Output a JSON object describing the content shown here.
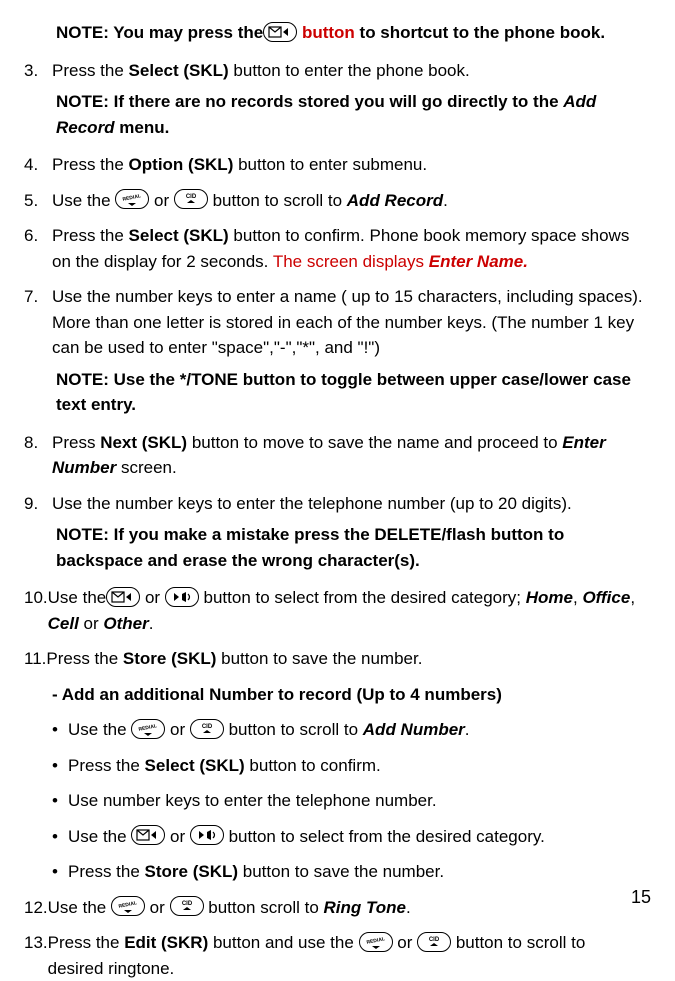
{
  "notes": {
    "shortcut": {
      "prefix": "NOTE: You may press the",
      "button_word": " button",
      "suffix": " to shortcut to the phone book."
    },
    "no_records": "NOTE: If there are no records stored you will go directly to the ",
    "no_records_italic": "Add Record",
    "no_records_end": " menu.",
    "tone_toggle": "NOTE: Use the */TONE button to toggle between upper case/lower case text entry.",
    "delete_flash": "NOTE: If you make a mistake press the DELETE/flash button to backspace and erase the wrong character(s)."
  },
  "steps": {
    "s3": {
      "num": "3.",
      "text_a": "Press the ",
      "bold_a": "Select (SKL)",
      "text_b": " button to enter the phone book."
    },
    "s4": {
      "num": "4.",
      "text_a": "Press the ",
      "bold_a": "Option (SKL)",
      "text_b": " button to enter submenu."
    },
    "s5": {
      "num": "5.",
      "text_a": "Use the ",
      "text_or": " or ",
      "text_b": " button to scroll to ",
      "italic_a": "Add Record",
      "text_c": "."
    },
    "s6": {
      "num": "6.",
      "text_a": "Press the ",
      "bold_a": "Select (SKL)",
      "text_b": " button to confirm. Phone book memory space shows on the display for 2 seconds. ",
      "red_a": "The screen displays ",
      "italic_a": "Enter Name."
    },
    "s7": {
      "num": "7.",
      "text_a": "Use the number keys to enter a name ( up to 15 characters, including spaces). More than one letter is stored in each of the number keys. (The number 1 key can be used to enter \"space\",\"-\",\"*\", and \"!\")"
    },
    "s8": {
      "num": "8.",
      "text_a": "Press ",
      "bold_a": "Next (SKL)",
      "text_b": " button to move to save the name and proceed to  ",
      "italic_a": "Enter Number",
      "text_c": " screen."
    },
    "s9": {
      "num": "9.",
      "text_a": "Use the number keys to enter the telephone number (up to 20 digits)."
    },
    "s10": {
      "num": "10.",
      "text_a": "Use the",
      "text_or": " or ",
      "text_b": " button to select from the desired category; ",
      "italic_a": "Home",
      "sep1": ", ",
      "italic_b": "Office",
      "sep2": ", ",
      "italic_c": "Cell",
      "text_c": " or ",
      "italic_d": "Other",
      "text_d": "."
    },
    "s11": {
      "num": "11.",
      "text_a": "Press the ",
      "bold_a": "Store (SKL)",
      "text_b": " button to save the number."
    },
    "s12": {
      "num": "12.",
      "text_a": "Use the ",
      "text_or": " or ",
      "text_b": " button scroll to ",
      "italic_a": "Ring Tone",
      "text_c": "."
    },
    "s13": {
      "num": "13.",
      "text_a": "Press the ",
      "bold_a": "Edit (SKR)",
      "text_b": " button and use the ",
      "text_or": " or ",
      "text_c": " button to scroll to desired ringtone."
    }
  },
  "sub_heading": "- Add an additional Number to record (Up to 4 numbers)",
  "bullets": {
    "b1": {
      "text_a": "Use the ",
      "text_or": " or ",
      "text_b": " button to scroll to ",
      "italic_a": "Add Number",
      "text_c": "."
    },
    "b2": {
      "text_a": "Press the ",
      "bold_a": "Select (SKL)",
      "text_b": " button to confirm."
    },
    "b3": {
      "text_a": "Use number keys to enter the telephone number."
    },
    "b4": {
      "text_a": "Use the ",
      "text_or": " or ",
      "text_b": " button to select from the desired category."
    },
    "b5": {
      "text_a": "Press the ",
      "bold_a": "Store (SKL)",
      "text_b": " button to save the number."
    }
  },
  "page_number": "15"
}
